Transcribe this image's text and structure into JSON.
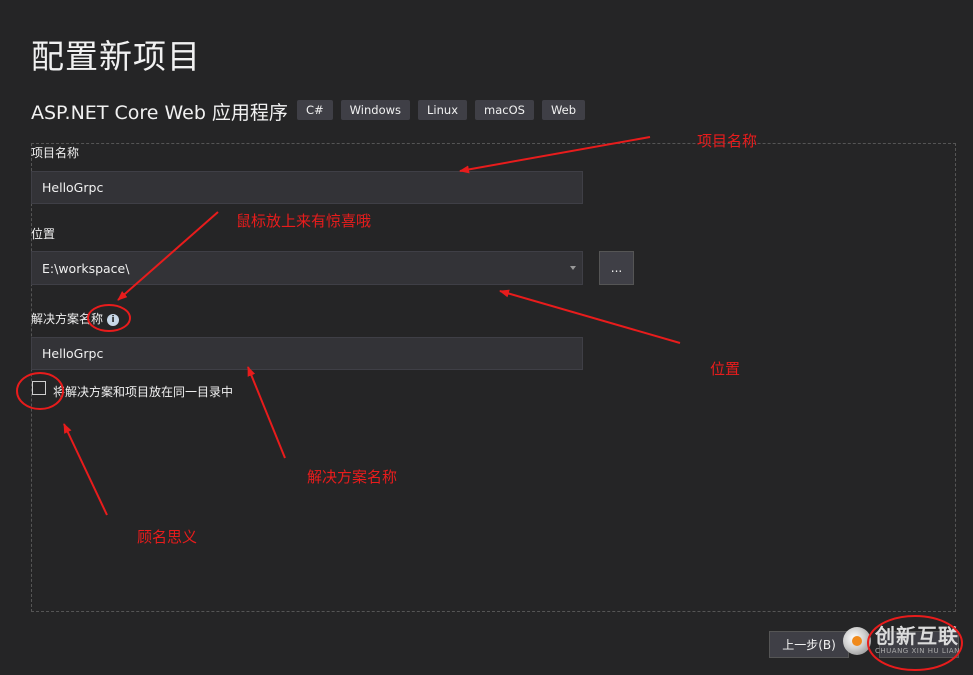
{
  "page": {
    "title": "配置新项目",
    "subtitle": "ASP.NET Core Web 应用程序",
    "tags": [
      "C#",
      "Windows",
      "Linux",
      "macOS",
      "Web"
    ]
  },
  "form": {
    "project_name_label": "项目名称",
    "project_name_value": "HelloGrpc",
    "location_label": "位置",
    "location_value": "E:\\workspace\\",
    "browse_label": "...",
    "solution_name_label": "解决方案名称",
    "solution_name_value": "HelloGrpc",
    "same_dir_label": "将解决方案和项目放在同一目录中",
    "same_dir_checked": false
  },
  "footer": {
    "back_label": "上一步(B)"
  },
  "annotations": {
    "project_name": "项目名称",
    "hover_tip": "鼠标放上来有惊喜哦",
    "location": "位置",
    "solution_name": "解决方案名称",
    "self_explanatory": "顾名思义"
  },
  "watermark": {
    "text": "创新互联",
    "sub": "CHUANG XIN HU LIAN"
  },
  "colors": {
    "background": "#252526",
    "field": "#333337",
    "annotation": "#e81c1c"
  },
  "icons": {
    "info": "info-icon",
    "dropdown": "chevron-down-icon"
  }
}
